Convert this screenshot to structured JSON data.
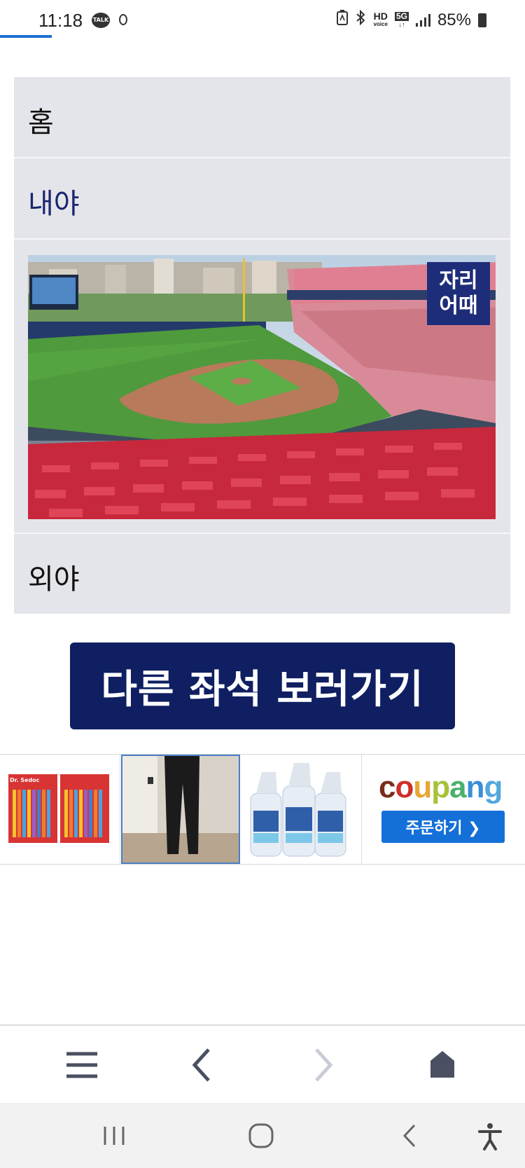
{
  "status_bar": {
    "time": "11:18",
    "talk_badge": "TALK",
    "network_hd": "HD",
    "network_voice": "voice",
    "network_5g": "5G",
    "battery_percent": "85%"
  },
  "menu": {
    "items": [
      {
        "label": "홈",
        "color": "#111111"
      },
      {
        "label": "내야",
        "color": "#1a2470"
      },
      {
        "label": "외야",
        "color": "#111111"
      }
    ],
    "photo_badge_line1": "자리",
    "photo_badge_line2": "어때"
  },
  "cta": {
    "label": "다른 좌석 보러가기"
  },
  "ads": {
    "coupang_logo": "coupang",
    "order_button": "주문하기 ❯",
    "toothbrush_brand": "Dr. Sedoc"
  },
  "browser_nav": {
    "icons": [
      "menu-icon",
      "back-icon",
      "forward-icon",
      "home-icon"
    ]
  },
  "system_nav": {
    "icons": [
      "recents-icon",
      "home-circle-icon",
      "back-icon",
      "accessibility-icon"
    ]
  },
  "colors": {
    "panel_bg": "#e4e5ea",
    "cta_bg": "#0f1f61",
    "badge_bg": "#1e2d7a",
    "coupang_button": "#1470d8"
  }
}
